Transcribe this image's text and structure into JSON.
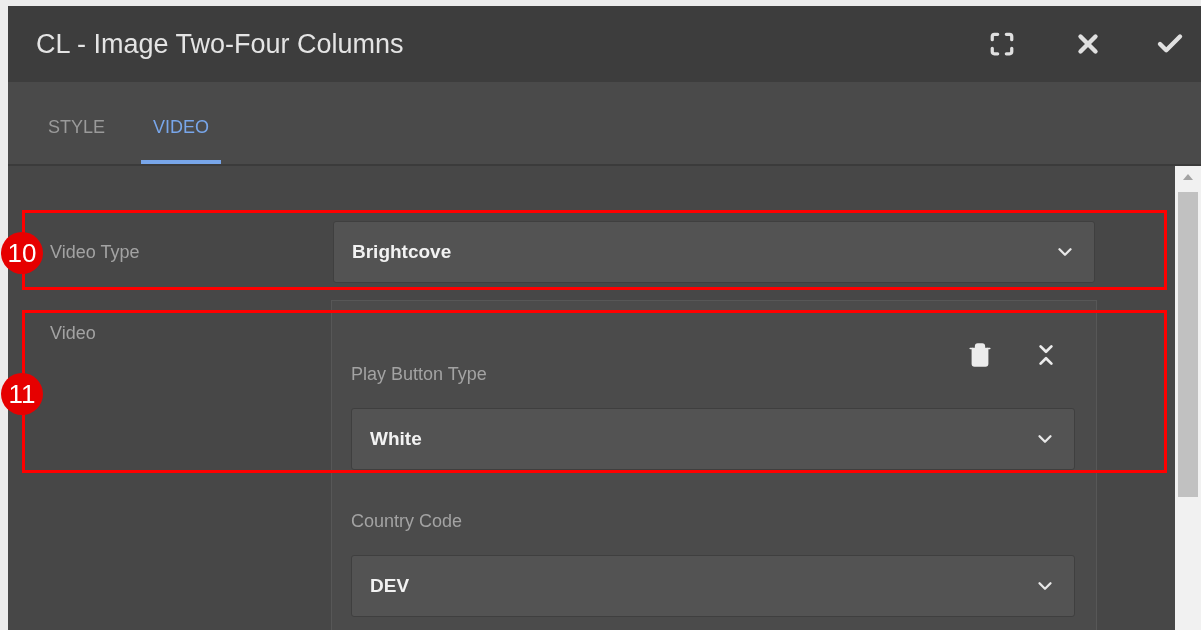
{
  "dialog": {
    "title": "CL - Image Two-Four Columns"
  },
  "tabs": [
    {
      "label": "STYLE",
      "selected": false
    },
    {
      "label": "VIDEO",
      "selected": true
    }
  ],
  "fields": [
    {
      "kind": "select",
      "label": "Video Type",
      "value": "Brightcove"
    },
    {
      "kind": "multifield",
      "label": "Video",
      "items": [
        {
          "label": "Play Button Type",
          "value": "White"
        },
        {
          "label": "Country Code",
          "value": "DEV"
        }
      ]
    }
  ],
  "annotations": [
    {
      "label": "10"
    },
    {
      "label": "11"
    }
  ]
}
